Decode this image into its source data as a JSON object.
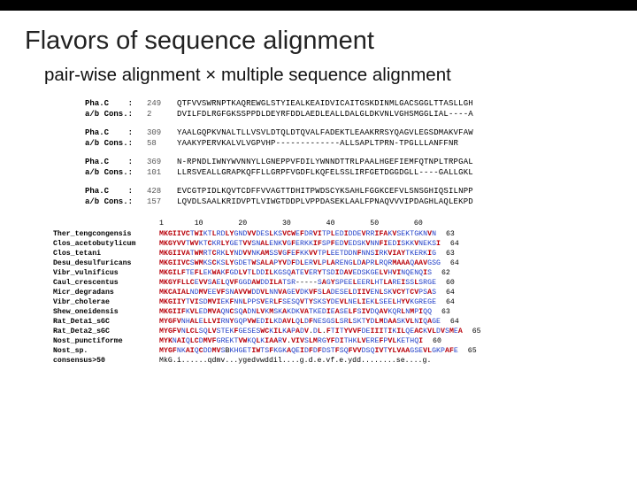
{
  "title": "Flavors of sequence alignment",
  "subtitle": "pair-wise alignment ×  multiple sequence alignment",
  "pairwise": [
    {
      "label": "Pha.C    :",
      "num": "249",
      "seq": "QTFVVSWRNPTKAQREWGLSTYIEALKEAIDVICAITGSKDINMLGACSGGLTTASLLGH"
    },
    {
      "label": "a/b Cons.:",
      "num": "2",
      "seq": "DVILFDLRGFGKSSPPDLDEYRFDDLAEDLEALLDALGLDKVNLVGHSMGGLIAL----A"
    },
    {
      "gap": true
    },
    {
      "label": "Pha.C    :",
      "num": "309",
      "seq": "YAALGQPKVNALTLLVSVLDTQLDTQVALFADEKTLEAAKRRSYQAGVLEGSDMAKVFAW"
    },
    {
      "label": "a/b Cons.:",
      "num": "58",
      "seq": "YAAKYPERVKALVLVGPVHP-------------ALLSAPLTPRN-TPGLLLANFFNR"
    },
    {
      "gap": true
    },
    {
      "label": "Pha.C    :",
      "num": "369",
      "seq": "N-RPNDLIWNYWVNNYLLGNEPPVFDILYWNNDTTRLPAALHGEFIEMFQTNPLTRPGAL"
    },
    {
      "label": "a/b Cons.:",
      "num": "101",
      "seq": "LLRSVEALLGRAPKQFFLLGRPFVGDFLKQFELSSLIRFGETDGGDGLL----GALLGKL"
    },
    {
      "gap": true
    },
    {
      "label": "Pha.C    :",
      "num": "428",
      "seq": "EVCGTPIDLKQVTCDFFVVAGTTDHITPWDSCYKSAHLFGGKCEFVLSNSGHIQSILNPP"
    },
    {
      "label": "a/b Cons.:",
      "num": "157",
      "seq": "LQVDLSAALKRIDVPTLVIWGTDDPLVPPDASEKLAALFPNAQVVVIPDAGHLAQLEKPD"
    }
  ],
  "ruler": "1       10        20        30        40        50        60",
  "msa": [
    {
      "label": "Ther_tengcongensis",
      "seq": "MKGIIVCTWIKTLRDLYGNDVVDESLKSVCWEFDRVITPLEDIDDEVRRIFAKVSEKTGKNVN"
    },
    {
      "label": "Clos_acetobutylicum",
      "seq": "MKGYVVTWVKTCKRLYGETVVSNALENKVGFERKKIFSPFEDVEDSKVNNFIEDISKKVNEKSI"
    },
    {
      "label": "Clos_tetani",
      "seq": "MKGIIVATWMRTCRKLYNDVVNKAMSSVGFEFKKVVTPLEETDDNFNNSIRKVIAYTKERKIG"
    },
    {
      "label": "Desu_desulfuricans",
      "seq": "MKGIIVCSWMKSCKSLYGDETWSALAPYVDFDLERVLPLARENGLDAPRLRQRMAAAQAAVGSG"
    },
    {
      "label": "Vibr_vulnificus",
      "seq": "MKGILFTEFLEKWAKFGDLVTLDDILKGSQATEVERYTSDIDAVEDSKGELVHVINQENQIS"
    },
    {
      "label": "Caul_crescentus",
      "seq": "MKGYFLLCEVVSAELQVFGGDAWDDILATSR-----SAGYSPEELEERLHTLAREISSLSRGE"
    },
    {
      "label": "Micr_degradans",
      "seq": "MKCAIALNDMVEEVFSNAVVWDDVLNNVAGEVDKVFSLADESELDIIVENLSKVCYTCVPSAS"
    },
    {
      "label": "Vibr_cholerae",
      "seq": "MKGIIYTVISDMVIEKFNNLPPSVERLFSESQVTYSKSYDEVLNELIEKLSEELHYVKGREGE"
    },
    {
      "label": "Shew_oneidensis",
      "seq": "MKGIIFKVLEDMVAQNCSQADNLVKMSKAKDKVATKEDIEASELFSIVDQAVKQRLNMPIQQ"
    },
    {
      "label": "Rat_Deta1_sGC",
      "seq": "MYGFVNHALELLVIRNYGQPVWEDILKDAVLQLDFNESGSLSRLSKTYDLMDAASKVLNIQAGE"
    },
    {
      "label": "Rat_Deta2_sGC",
      "seq": "MYGFVNLCLSQLVSTEKFGESESWCKILKAPADV.DL.FTITYVVFDEIIITIKILQEACKVLDVSMEA"
    },
    {
      "label": "Nost_punctiforme",
      "seq": "MYKNAIQLCDMVFGREKTVWKQLKIAARV.VIVSLMRGYFDITHKLVEREFPVLKETHQI"
    },
    {
      "label": "Nost_sp.",
      "seq": "MYGFNKAIQCDDMVSBKHGETIWTSFKGKAQEIDFDFDSTFSQFVVDSQIVTYLVAAGSEVLGKPAFE"
    },
    {
      "label": "consensus>50",
      "seq": "MkG.i......qdmv...ygedvwddil....g.d.e.vf.e.ydd........se....g.",
      "cons": true
    }
  ],
  "msa_end_nums": [
    "63",
    "64",
    "63",
    "64",
    "62",
    "60",
    "64",
    "64",
    "63",
    "64",
    "65",
    "60",
    "65",
    ""
  ]
}
